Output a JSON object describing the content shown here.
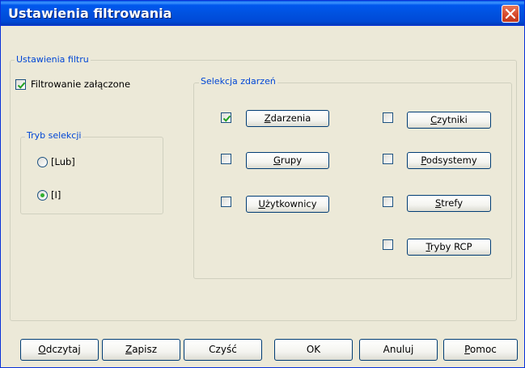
{
  "window": {
    "title": "Ustawienia filtrowania"
  },
  "filter_group": {
    "title": "Ustawienia filtru",
    "enable_checkbox": {
      "label": "Filtrowanie załączone",
      "checked": true
    }
  },
  "mode_group": {
    "title": "Tryb selekcji",
    "options": [
      {
        "label": "[Lub]",
        "selected": false
      },
      {
        "label": "[I]",
        "selected": true
      }
    ]
  },
  "events_group": {
    "title": "Selekcja zdarzeń",
    "left": [
      {
        "label": "Zdarzenia",
        "underline": "Z",
        "rest": "darzenia",
        "checked": true
      },
      {
        "label": "Grupy",
        "underline": "G",
        "rest": "rupy",
        "checked": false
      },
      {
        "label": "Użytkownicy",
        "underline": "U",
        "rest": "żytkownicy",
        "checked": false
      }
    ],
    "right": [
      {
        "label": "Czytniki",
        "underline": "C",
        "rest": "zytniki",
        "checked": false
      },
      {
        "label": "Podsystemy",
        "underline": "P",
        "rest": "odsystemy",
        "checked": false
      },
      {
        "label": "Strefy",
        "underline": "S",
        "rest": "trefy",
        "checked": false
      },
      {
        "label": "Tryby RCP",
        "underline": "T",
        "rest": "ryby RCP",
        "checked": false
      }
    ]
  },
  "buttons": {
    "read": {
      "underline": "O",
      "rest": "dczytaj"
    },
    "save": {
      "underline": "Z",
      "rest": "apisz"
    },
    "clear": {
      "label": "Czyść"
    },
    "ok": {
      "label": "OK"
    },
    "cancel": {
      "label": "Anuluj"
    },
    "help": {
      "underline": "P",
      "rest": "omoc"
    }
  },
  "colors": {
    "title_bar": "#0054e3",
    "group_label": "#0046d5",
    "check_mark": "#21a121",
    "radio_dot": "#31b02d",
    "close_button": "#d7482a"
  }
}
